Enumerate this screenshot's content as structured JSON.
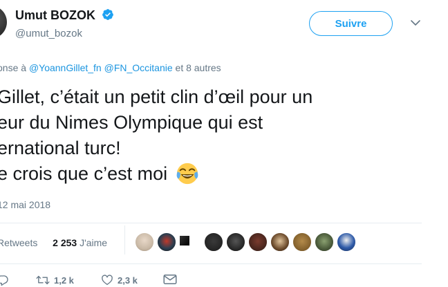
{
  "user": {
    "display_name": "Umut BOZOK",
    "handle": "@umut_bozok"
  },
  "follow_button": {
    "label": "Suivre"
  },
  "reply": {
    "prefix": "onse à",
    "mention_1": "@YoannGillet_fn",
    "mention_2": "@FN_Occitanie",
    "suffix": "et 8 autres"
  },
  "tweet": {
    "line_1": "Gillet, c’était un petit clin d’œil pour un",
    "line_2": "eur du Nimes Olympique qui est",
    "line_3": "ernational turc!",
    "line_4": "e crois que c’est moi",
    "emoji": "face-with-tears-of-joy"
  },
  "timestamp": "12 mai 2018",
  "stats": {
    "retweets_label": "Retweets",
    "likes_count": "2 253",
    "likes_label": "J'aime"
  },
  "actions": {
    "reply_count": "",
    "retweet_count": "1,2 k",
    "like_count": "2,3 k"
  },
  "colors": {
    "accent": "#1da1f2",
    "link": "#1b95e0",
    "muted": "#657786",
    "text": "#14171a",
    "divider": "#e6ecf0"
  },
  "icons": {
    "verified": "verified-badge-icon",
    "caret": "chevron-down-icon",
    "reply": "reply-icon",
    "retweet": "retweet-icon",
    "like": "heart-icon",
    "message": "envelope-icon"
  }
}
